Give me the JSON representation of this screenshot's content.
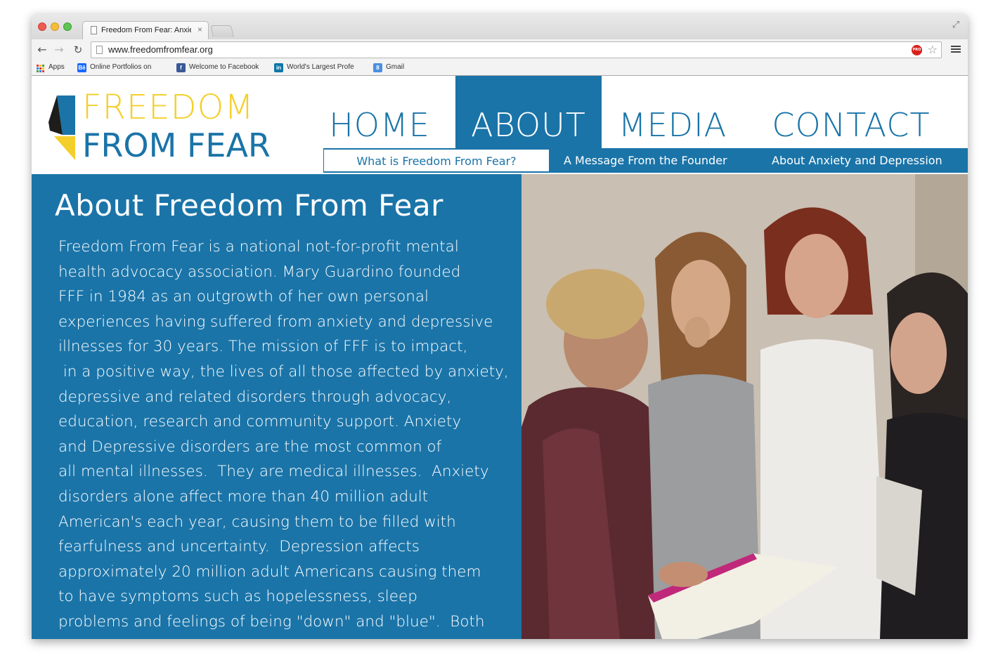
{
  "browser": {
    "tab_title": "Freedom From Fear: Anxiety",
    "tab_close": "×",
    "url": "www.freedomfromfear.org",
    "bookmarks": [
      {
        "label": "Apps",
        "icon": "apps-grid-icon"
      },
      {
        "label": "Online Portfolios on",
        "icon": "behance-icon",
        "glyph": "Bē"
      },
      {
        "label": "Welcome to Facebook",
        "icon": "facebook-icon",
        "glyph": "f"
      },
      {
        "label": "World's Largest Profe",
        "icon": "linkedin-icon",
        "glyph": "in"
      },
      {
        "label": "Gmail",
        "icon": "google-icon",
        "glyph": "8"
      }
    ],
    "extension_badge": "PRO"
  },
  "site": {
    "logo": {
      "line1": "FREEDOM",
      "line2": "FROM FEAR"
    },
    "nav": [
      "HOME",
      "ABOUT",
      "MEDIA",
      "CONTACT"
    ],
    "active_nav": "ABOUT",
    "subnav": [
      "What is Freedom From Fear?",
      "A Message From the Founder",
      "About Anxiety and Depression"
    ],
    "active_subnav": "What is Freedom From Fear?",
    "heading": "About Freedom From Fear",
    "body_lines": [
      "Freedom From Fear is a national not-for-profit mental",
      "health advocacy association. Mary Guardino founded",
      "FFF in 1984 as an outgrowth of her own personal",
      "experiences having suffered from anxiety and depressive",
      "illnesses for 30 years. The mission of FFF is to impact,",
      " in a positive way, the lives of all those affected by anxiety,",
      "depressive and related disorders through advocacy,",
      "education, research and community support. Anxiety",
      "and Depressive disorders are the most common of",
      "all mental illnesses.  They are medical illnesses.  Anxiety",
      "disorders alone affect more than 40 million adult",
      "American's each year, causing them to be filled with",
      "fearfulness and uncertainty.  Depression affects",
      "approximately 20 million adult Americans causing them",
      "to have symptoms such as hopelessness, sleep",
      "problems and feelings of being \"down\" and \"blue\".  Both"
    ],
    "colors": {
      "blue": "#1a74a8",
      "yellow": "#f4cf2c",
      "white": "#ffffff"
    }
  }
}
